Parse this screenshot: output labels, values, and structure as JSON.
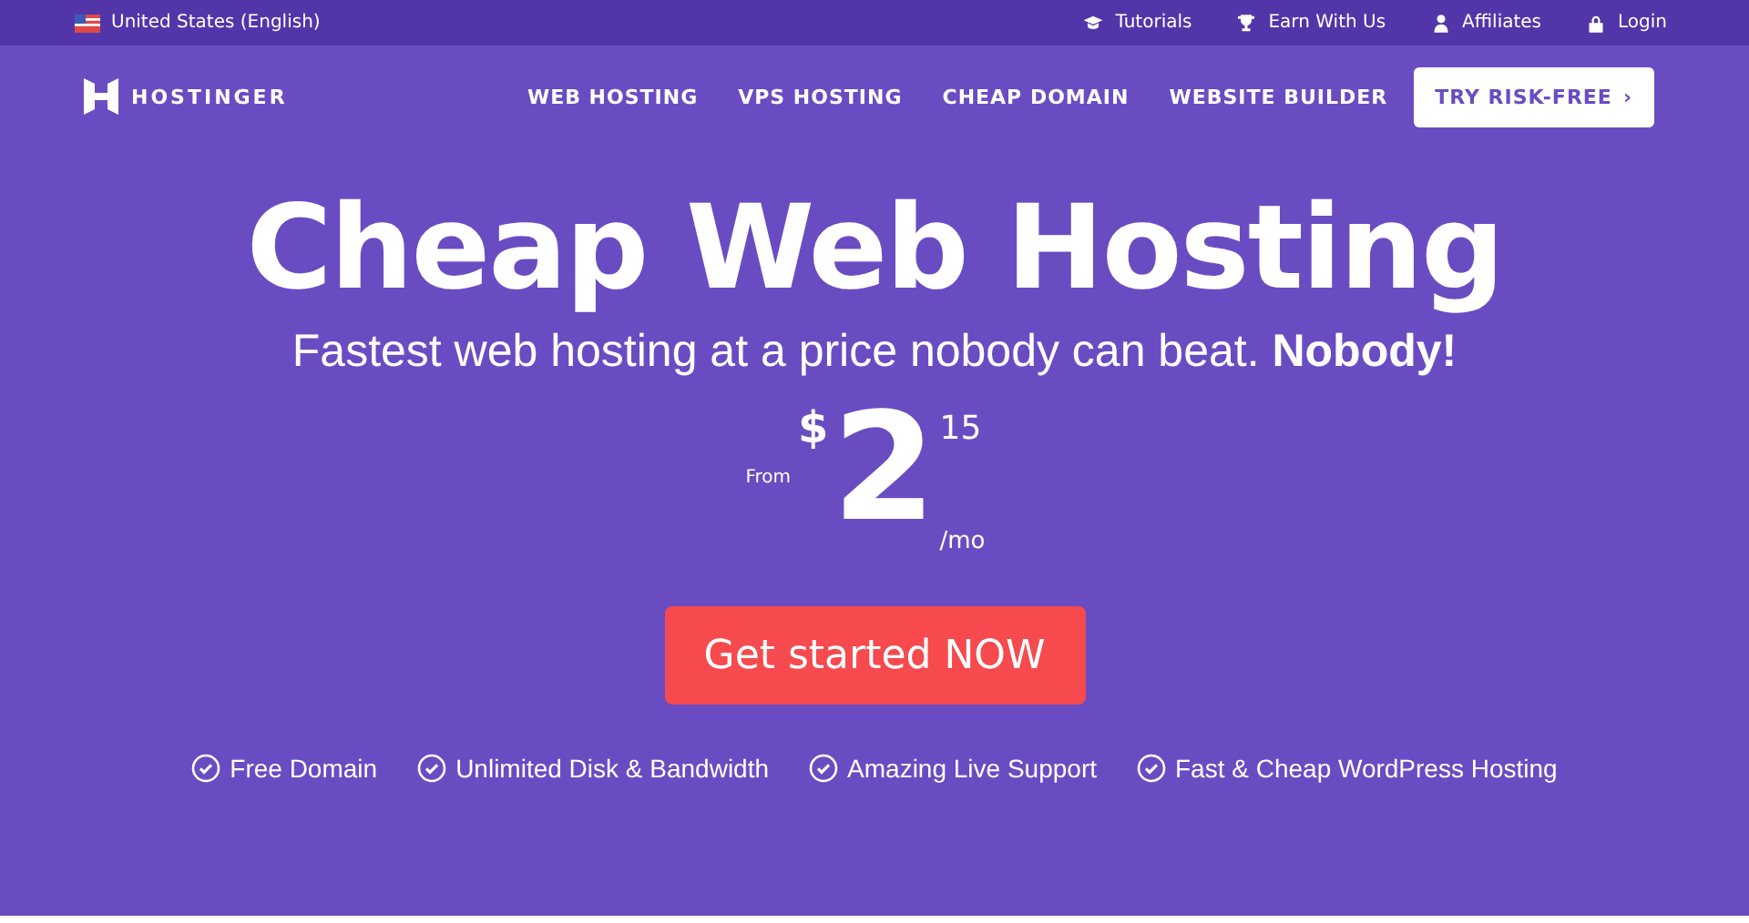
{
  "top_bar": {
    "locale": "United States (English)",
    "links": [
      {
        "kind": "cap",
        "label": "Tutorials"
      },
      {
        "kind": "trophy",
        "label": "Earn With Us"
      },
      {
        "kind": "person",
        "label": "Affiliates"
      },
      {
        "kind": "lock",
        "label": "Login"
      }
    ]
  },
  "nav": {
    "logo": "HOSTINGER",
    "items": [
      "WEB HOSTING",
      "VPS HOSTING",
      "CHEAP DOMAIN",
      "WEBSITE BUILDER"
    ],
    "cta": "TRY RISK-FREE",
    "cta_arrow": "›"
  },
  "hero": {
    "title": "Cheap Web Hosting",
    "subtitle": "Fastest web hosting at a price nobody can beat. **Nobody!**",
    "price": {
      "prefix": "From",
      "currency": "$",
      "whole": "2",
      "cents": "15",
      "period": "/mo"
    },
    "button": "Get started NOW",
    "features": [
      "Free Domain",
      "Unlimited Disk & Bandwidth",
      "Amazing Live Support",
      "Fast & Cheap WordPress Hosting"
    ]
  }
}
